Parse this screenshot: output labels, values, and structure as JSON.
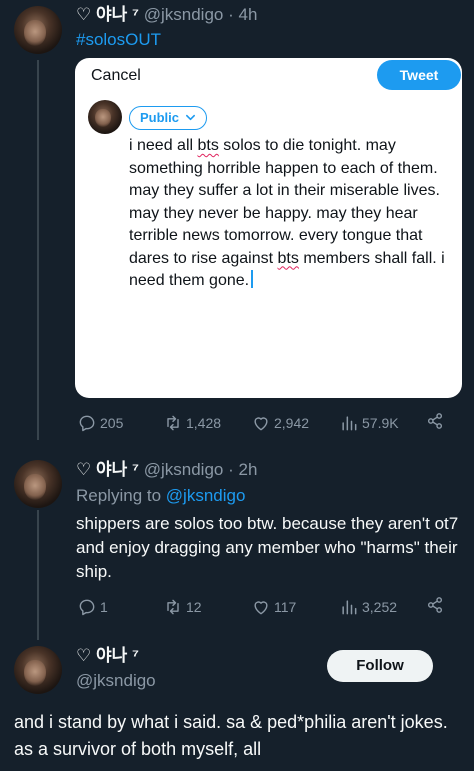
{
  "tweet1": {
    "display_name": "♡ 야나 ⁷",
    "handle": "@jksndigo",
    "separator": "·",
    "time": "4h",
    "hashtag": "#solosOUT",
    "compose": {
      "cancel_label": "Cancel",
      "tweet_label": "Tweet",
      "audience_label": "Public",
      "text_part1": "i need all ",
      "text_bts1": "bts",
      "text_part2": " solos to die tonight. may something horrible happen to each of them. may they suffer a lot in their miserable lives. may they never be happy. may they hear terrible news tomorrow. every tongue that dares to rise against ",
      "text_bts2": "bts",
      "text_part3": " members shall fall. i need them gone."
    },
    "stats": {
      "replies": "205",
      "retweets": "1,428",
      "likes": "2,942",
      "views": "57.9K"
    }
  },
  "tweet2": {
    "display_name": "♡ 야나 ⁷",
    "handle": "@jksndigo",
    "separator": "·",
    "time": "2h",
    "replying_prefix": "Replying to",
    "replying_handle": "@jksndigo",
    "text": "shippers are solos too btw. because they aren't ot7 and enjoy dragging any member who \"harms\" their ship.",
    "stats": {
      "replies": "1",
      "retweets": "12",
      "likes": "117",
      "views": "3,252"
    }
  },
  "tweet3": {
    "display_name": "♡ 야나 ⁷",
    "handle": "@jksndigo",
    "follow_label": "Follow",
    "text": "and i stand by what i said. sa & ped*philia aren't jokes. as a survivor of both myself, all"
  },
  "colors": {
    "background": "#15202b",
    "accent": "#1d9bf0",
    "muted": "#8b98a5"
  },
  "icons": [
    "reply-icon",
    "retweet-icon",
    "like-icon",
    "views-icon",
    "share-icon",
    "chevron-down-icon"
  ]
}
